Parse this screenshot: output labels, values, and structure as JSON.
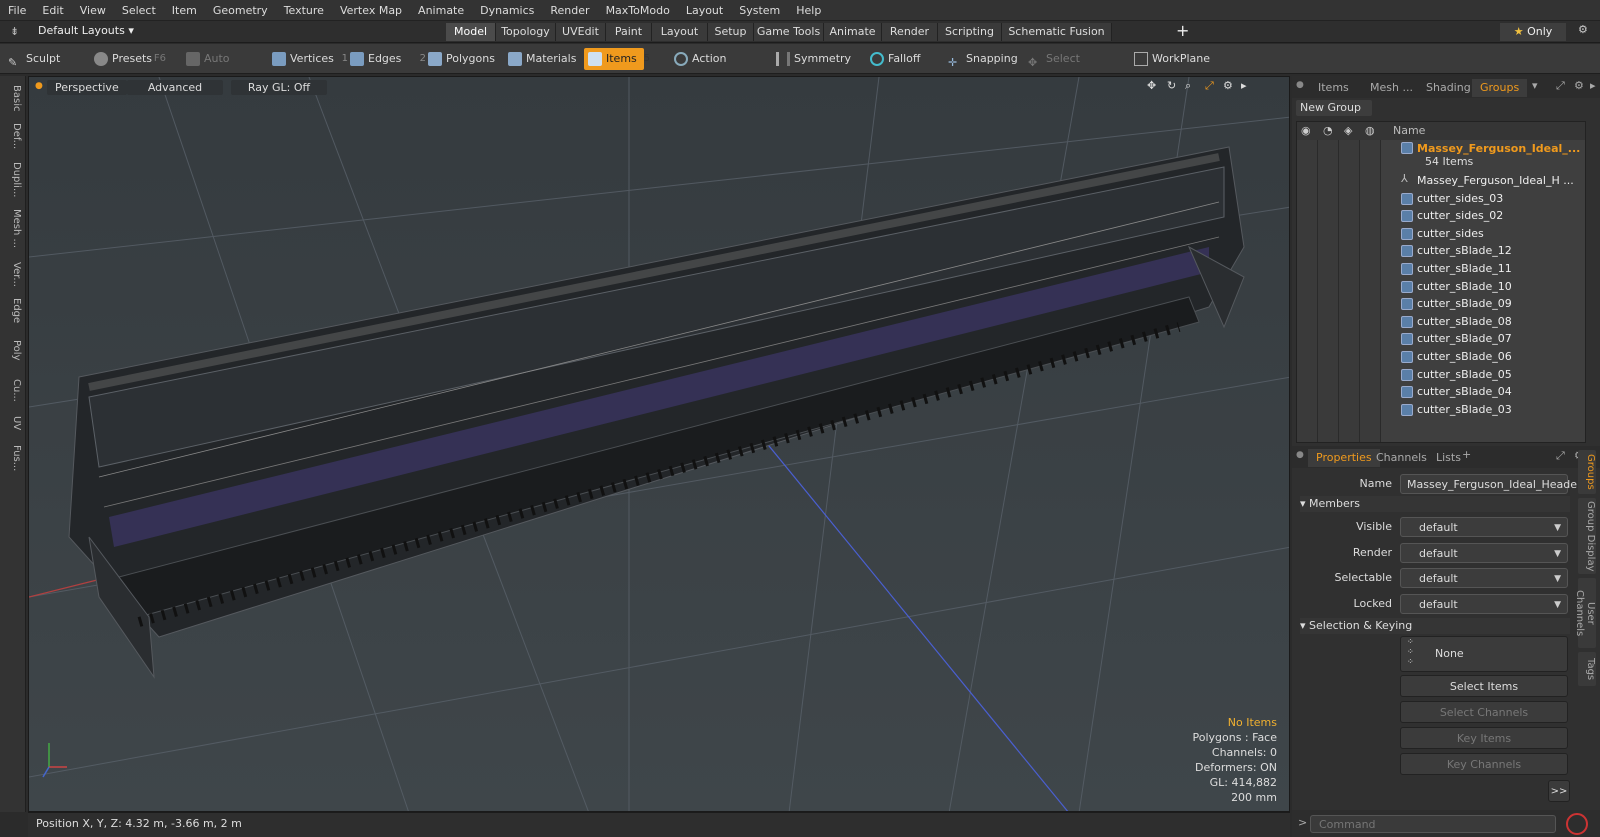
{
  "menu": [
    "File",
    "Edit",
    "View",
    "Select",
    "Item",
    "Geometry",
    "Texture",
    "Vertex Map",
    "Animate",
    "Dynamics",
    "Render",
    "MaxToModo",
    "Layout",
    "System",
    "Help"
  ],
  "layout_bar": {
    "layout_dropdown": "Default Layouts",
    "tabs": [
      "Model",
      "Topology",
      "UVEdit",
      "Paint",
      "Layout",
      "Setup",
      "Game Tools",
      "Animate",
      "Render",
      "Scripting",
      "Schematic Fusion"
    ],
    "active_tab": "Model",
    "plus": "+",
    "only_label": "Only"
  },
  "toolbar": {
    "sculpt": "Sculpt",
    "presets": "Presets",
    "presets_key": "F6",
    "auto_select": "Auto Select",
    "vertices": "Vertices",
    "vertices_num": "1",
    "edges": "Edges",
    "edges_num": "2",
    "polygons": "Polygons",
    "materials": "Materials",
    "items": "Items",
    "items_num": "5",
    "action_center": "Action Center",
    "symmetry": "Symmetry",
    "falloff": "Falloff",
    "snapping": "Snapping",
    "select_through": "Select Through",
    "workplane": "WorkPlane"
  },
  "left_tabs": [
    "Basic",
    "Def...",
    "Dupli...",
    "Mesh ...",
    "Ver...",
    "Edge",
    "Poly",
    "Cu...",
    "UV",
    "Fus..."
  ],
  "viewport": {
    "view": "Perspective",
    "shading": "Advanced",
    "raygl": "Ray GL: Off",
    "hud": {
      "no_items": "No Items",
      "polygons": "Polygons : Face",
      "channels": "Channels: 0",
      "deformers": "Deformers: ON",
      "gl": "GL: 414,882",
      "scale": "200 mm"
    }
  },
  "status": "Position X, Y, Z:   4.32 m, -3.66 m, 2 m",
  "right_panel": {
    "tabs": [
      "Items",
      "Mesh ...",
      "Shading",
      "Groups"
    ],
    "active_tab": "Groups",
    "new_group": "New Group",
    "name_header": "Name",
    "group_name": "Massey_Ferguson_Ideal_...",
    "group_count": "54 Items",
    "items": [
      "Massey_Ferguson_Ideal_H ...",
      "cutter_sides_03",
      "cutter_sides_02",
      "cutter_sides",
      "cutter_sBlade_12",
      "cutter_sBlade_11",
      "cutter_sBlade_10",
      "cutter_sBlade_09",
      "cutter_sBlade_08",
      "cutter_sBlade_07",
      "cutter_sBlade_06",
      "cutter_sBlade_05",
      "cutter_sBlade_04",
      "cutter_sBlade_03"
    ]
  },
  "properties": {
    "tabs": [
      "Properties",
      "Channels",
      "Lists"
    ],
    "active_tab": "Properties",
    "plus": "+",
    "name_label": "Name",
    "name_value": "Massey_Ferguson_Ideal_Header",
    "members_label": "Members",
    "visible_label": "Visible",
    "visible_value": "default",
    "render_label": "Render",
    "render_value": "default",
    "selectable_label": "Selectable",
    "selectable_value": "default",
    "locked_label": "Locked",
    "locked_value": "default",
    "selection_keying_label": "Selection & Keying",
    "none_label": "None",
    "select_items": "Select Items",
    "select_channels": "Select Channels",
    "key_items": "Key Items",
    "key_channels": "Key Channels",
    "more": ">>"
  },
  "side_tabs": [
    "Groups",
    "Group Display",
    "User Channels",
    "Tags"
  ],
  "command_placeholder": "Command",
  "colors": {
    "accent": "#f09a1d",
    "bg": "#2b2b2b",
    "viewport": "#3c4246"
  }
}
